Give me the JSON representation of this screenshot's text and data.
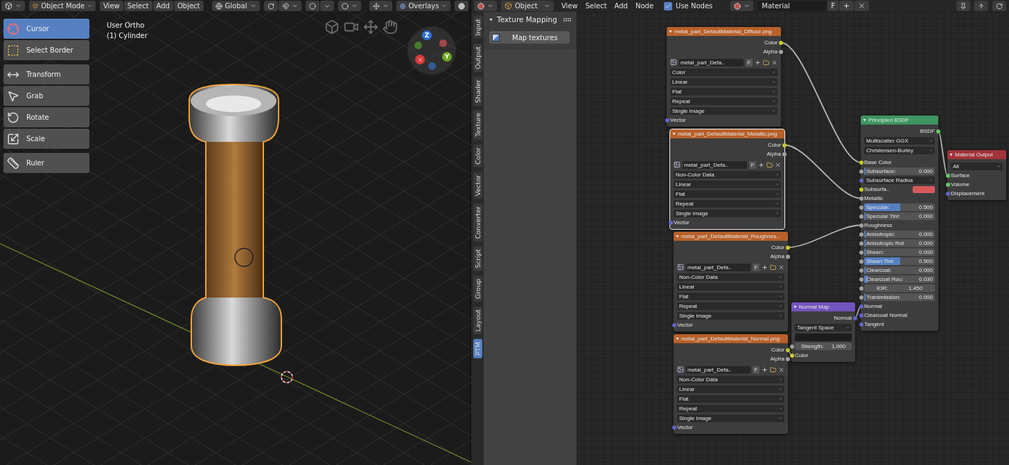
{
  "viewport_header": {
    "mode": "Object Mode",
    "menus": [
      "View",
      "Select",
      "Add",
      "Object"
    ],
    "orientation": "Global",
    "overlays": "Overlays"
  },
  "viewport": {
    "view_name": "User Ortho",
    "object_name": "(1) Cylinder",
    "axes": [
      {
        "label": "Z",
        "color": "#2f72d9"
      },
      {
        "label": "Y",
        "color": "#6ea61f"
      }
    ]
  },
  "tool_groups": [
    [
      {
        "label": "Cursor",
        "kind": "cursor",
        "selected": true
      },
      {
        "label": "Select Border",
        "kind": "select",
        "selected": false
      }
    ],
    [
      {
        "label": "Transform",
        "kind": "transform",
        "selected": false
      },
      {
        "label": "Grab",
        "kind": "grab",
        "selected": false
      },
      {
        "label": "Rotate",
        "kind": "rotate",
        "selected": false
      },
      {
        "label": "Scale",
        "kind": "scale",
        "selected": false
      }
    ],
    [
      {
        "label": "Ruler",
        "kind": "ruler",
        "selected": false
      }
    ]
  ],
  "node_header": {
    "object": "Object",
    "menus": [
      "View",
      "Select",
      "Add",
      "Node"
    ],
    "use_nodes": {
      "label": "Use Nodes",
      "checked": true
    },
    "material": "Material",
    "fake_user": "F"
  },
  "sidebar_tabs": [
    {
      "label": "Input",
      "selected": false
    },
    {
      "label": "Output",
      "selected": false
    },
    {
      "label": "Shader",
      "selected": false
    },
    {
      "label": "Texture",
      "selected": false
    },
    {
      "label": "Color",
      "selected": false
    },
    {
      "label": "Vector",
      "selected": false
    },
    {
      "label": "Converter",
      "selected": false
    },
    {
      "label": "Script",
      "selected": false
    },
    {
      "label": "Group",
      "selected": false
    },
    {
      "label": "Layout",
      "selected": false
    },
    {
      "label": "PTM",
      "selected": true
    }
  ],
  "panel": {
    "title": "Texture Mapping",
    "expanded": true,
    "button": "Map textures"
  },
  "nodes": [
    {
      "kind": "image",
      "title": "metal_part_DefaultMaterial_Diffuse.png",
      "selected": false,
      "outputs": [
        {
          "label": "Color",
          "socket": {
            "color": "#c7c729"
          }
        },
        {
          "label": "Alpha",
          "socket": {
            "color": "#a1a1a1"
          }
        }
      ],
      "image": "metal_part_Defa..",
      "fake_user": "F",
      "options": [
        "Color",
        "Linear",
        "Flat",
        "Repeat",
        "Single Image"
      ],
      "inputs": [
        {
          "kind": "socket",
          "label": "Vector",
          "socket": {
            "color": "#6363c7"
          }
        }
      ]
    },
    {
      "kind": "image",
      "title": "metal_part_DefaultMaterial_Metallic.png",
      "selected": true,
      "outputs": [
        {
          "label": "Color",
          "socket": {
            "color": "#c7c729"
          }
        },
        {
          "label": "Alpha",
          "socket": {
            "color": "#a1a1a1"
          }
        }
      ],
      "image": "metal_part_Defa..",
      "fake_user": "F",
      "options": [
        "Non-Color Data",
        "Linear",
        "Flat",
        "Repeat",
        "Single Image"
      ],
      "inputs": [
        {
          "kind": "socket",
          "label": "Vector",
          "socket": {
            "color": "#6363c7"
          }
        }
      ]
    },
    {
      "kind": "image",
      "title": "metal_part_DefaultMaterial_Roughnes...",
      "selected": false,
      "outputs": [
        {
          "label": "Color",
          "socket": {
            "color": "#c7c729"
          }
        },
        {
          "label": "Alpha",
          "socket": {
            "color": "#a1a1a1"
          }
        }
      ],
      "image": "metal_part_Defa..",
      "fake_user": "F",
      "options": [
        "Non-Color Data",
        "Linear",
        "Flat",
        "Repeat",
        "Single Image"
      ],
      "inputs": [
        {
          "kind": "socket",
          "label": "Vector",
          "socket": {
            "color": "#6363c7"
          }
        }
      ]
    },
    {
      "kind": "image",
      "title": "metal_part_DefaultMaterial_Normal.png",
      "selected": false,
      "outputs": [
        {
          "label": "Color",
          "socket": {
            "color": "#c7c729"
          }
        },
        {
          "label": "Alpha",
          "socket": {
            "color": "#a1a1a1"
          }
        }
      ],
      "image": "metal_part_Defa..",
      "fake_user": "F",
      "options": [
        "Non-Color Data",
        "Linear",
        "Flat",
        "Repeat",
        "Single Image"
      ],
      "inputs": [
        {
          "kind": "socket",
          "label": "Vector",
          "socket": {
            "color": "#6363c7"
          }
        }
      ]
    },
    {
      "kind": "bsdf",
      "title": "Principled BSDF",
      "selected": false,
      "outputs": [
        {
          "label": "BSDF",
          "socket": {
            "color": "#63c763"
          }
        }
      ],
      "options": [
        "Multiscatter GGX",
        "Christensen-Burley"
      ],
      "inputs": [
        {
          "kind": "socket",
          "label": "Base Color",
          "socket": {
            "color": "#c7c729"
          }
        },
        {
          "kind": "slider",
          "label": "Subsurface:",
          "value": "0.000",
          "level": 0,
          "socket": {
            "color": "#a1a1a1"
          }
        },
        {
          "kind": "dropdown",
          "label": "Subsurface Radius",
          "socket": {
            "color": "#6363c7"
          }
        },
        {
          "kind": "color",
          "label": "Subsurfa..",
          "color": "#d65a5a",
          "socket": {
            "color": "#c7c729"
          }
        },
        {
          "kind": "socket",
          "label": "Metallic",
          "socket": {
            "color": "#a1a1a1"
          }
        },
        {
          "kind": "slider",
          "label": "Specular:",
          "value": "0.500",
          "level": 0.5,
          "socket": {
            "color": "#a1a1a1"
          }
        },
        {
          "kind": "slider",
          "label": "Specular Tint:",
          "value": "0.000",
          "level": 0,
          "socket": {
            "color": "#a1a1a1"
          }
        },
        {
          "kind": "socket",
          "label": "Roughness",
          "socket": {
            "color": "#a1a1a1"
          }
        },
        {
          "kind": "slider",
          "label": "Anisotropic:",
          "value": "0.000",
          "level": 0,
          "socket": {
            "color": "#a1a1a1"
          }
        },
        {
          "kind": "slider",
          "label": "Anisotropic Rot",
          "value": "0.000",
          "level": 0,
          "socket": {
            "color": "#a1a1a1"
          }
        },
        {
          "kind": "slider",
          "label": "Sheen:",
          "value": "0.000",
          "level": 0,
          "socket": {
            "color": "#a1a1a1"
          }
        },
        {
          "kind": "slider",
          "label": "Sheen Tint:",
          "value": "0.500",
          "level": 0.5,
          "socket": {
            "color": "#a1a1a1"
          }
        },
        {
          "kind": "slider",
          "label": "Clearcoat:",
          "value": "0.000",
          "level": 0,
          "socket": {
            "color": "#a1a1a1"
          }
        },
        {
          "kind": "slider",
          "label": "Clearcoat Rou:",
          "value": "0.030",
          "level": 0.03,
          "socket": {
            "color": "#a1a1a1"
          }
        },
        {
          "kind": "number",
          "label": "IOR:",
          "value": "1.450",
          "socket": {
            "color": "#a1a1a1"
          }
        },
        {
          "kind": "slider",
          "label": "Transmission:",
          "value": "0.000",
          "level": 0,
          "socket": {
            "color": "#a1a1a1"
          }
        },
        {
          "kind": "socket",
          "label": "Normal",
          "socket": {
            "color": "#6363c7"
          }
        },
        {
          "kind": "socket",
          "label": "Clearcoat Normal",
          "socket": {
            "color": "#6363c7"
          }
        },
        {
          "kind": "socket",
          "label": "Tangent",
          "socket": {
            "color": "#6363c7"
          }
        }
      ]
    },
    {
      "kind": "normal_map",
      "title": "Normal Map",
      "selected": false,
      "outputs": [
        {
          "label": "Normal",
          "socket": {
            "color": "#6363c7"
          }
        }
      ],
      "options": [
        "Tangent Space"
      ],
      "inputs": [
        {
          "kind": "field"
        },
        {
          "kind": "number",
          "label": "Strength:",
          "value": "1.000",
          "socket": {
            "color": "#a1a1a1"
          }
        },
        {
          "kind": "socket",
          "label": "Color",
          "socket": {
            "color": "#c7c729"
          }
        }
      ]
    },
    {
      "kind": "output",
      "title": "Material Output",
      "selected": false,
      "options": [
        "All"
      ],
      "inputs": [
        {
          "kind": "socket",
          "label": "Surface",
          "socket": {
            "color": "#63c763"
          }
        },
        {
          "kind": "socket",
          "label": "Volume",
          "socket": {
            "color": "#63c763"
          }
        },
        {
          "kind": "socket",
          "label": "Displacement",
          "socket": {
            "color": "#6363c7"
          }
        }
      ]
    }
  ]
}
